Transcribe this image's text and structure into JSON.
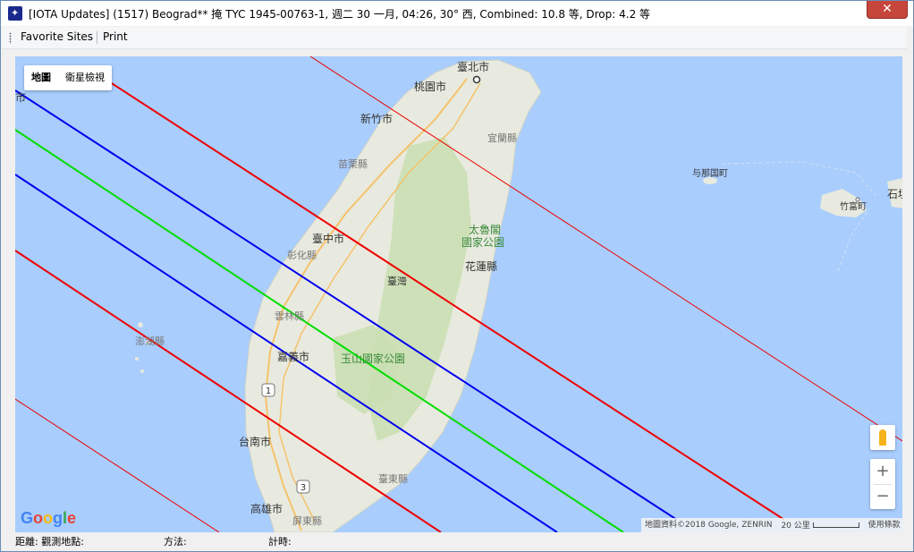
{
  "window": {
    "title": "[IOTA Updates] (1517) Beograd** 掩 TYC 1945-00763-1, 週二 30 一月, 04:26, 30° 西, Combined: 10.8 等, Drop:  4.2 等",
    "close_glyph": "✕"
  },
  "menu": {
    "items": [
      {
        "label": "Favorite Sites"
      },
      {
        "label": "Print"
      }
    ]
  },
  "map": {
    "type_buttons": [
      {
        "label": "地圖"
      },
      {
        "label": "衛星檢視"
      }
    ],
    "labels": {
      "taipei": "臺北市",
      "taoyuan": "桃園市",
      "hsinchu": "新竹市",
      "yilan": "宜蘭縣",
      "miaoli": "苗栗縣",
      "taichung": "臺中市",
      "changhua": "彰化縣",
      "taroko": "太魯閣",
      "taroko2": "國家公園",
      "hualien": "花蓮縣",
      "taiwan": "臺灣",
      "yunlin": "雲林縣",
      "penghu": "澎湖縣",
      "chiayi": "嘉義市",
      "yushan": "玉山國家公園",
      "tainan": "台南市",
      "taitung": "臺東縣",
      "kaohsiung": "高雄市",
      "pingtung": "屏東縣",
      "yonaguni": "与那国町",
      "taketomi": "竹富町",
      "ishigaki": "石垣",
      "edge_label": "市",
      "route1": "1",
      "route3": "3"
    },
    "google_logo": "Google",
    "attribution": "地圖資料©2018 Google, ZENRIN",
    "scale_label": "20 公里",
    "terms": "使用條款",
    "zoom_in": "+",
    "zoom_out": "−",
    "colors": {
      "sea": "#a9cdfd",
      "land": "#e8eadf",
      "forest": "#c9deb1",
      "central_line": "#00dd00",
      "limit_line": "#0000ee",
      "sigma_line": "#ee0000"
    }
  },
  "status": {
    "distance_label": "距離: 觀測地點:",
    "method_label": "方法:",
    "timing_label": "計時:"
  }
}
